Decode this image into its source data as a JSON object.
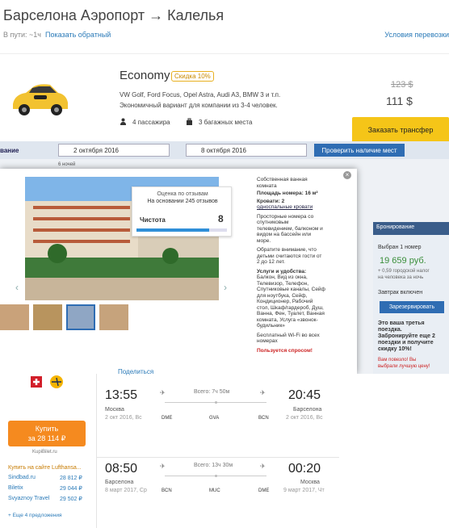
{
  "header": {
    "title": "Барселона Аэропорт → Калелья",
    "duration": "В пути: ~1ч",
    "show_return": "Показать обратный",
    "conditions": "Условия перевозки"
  },
  "transfer": {
    "class_name": "Economy",
    "discount": "Скидка 10%",
    "cars": "VW Golf, Ford Focus, Opel Astra, Audi A3, BMW 3 и т.п.",
    "description": "Экономичный вариант для компании из 3-4 человек.",
    "passengers": "4 пассажира",
    "bags": "3 багажных места",
    "old_price": "123 $",
    "new_price": "111 $",
    "order_button": "Заказать трансфер",
    "car_color": "#f2c230"
  },
  "hotel_bg": {
    "ot_label": "вание",
    "checkin": "2 октября 2016",
    "checkout": "8 октября 2016",
    "check_button": "Проверить наличие мест",
    "nights": "6 ночей",
    "booking_header": "Бронирование",
    "selected": "Выбран 1 номер",
    "price": "19 659 руб.",
    "tax": "+ 0,59 городской налог",
    "tax2": "на человека за ночь",
    "breakfast": "Завтрак включен",
    "reserve_button": "Зарезервировать",
    "third": "Это ваша третья",
    "third2": "поездка.",
    "third3": "Забронируйте еще 2",
    "third4": "поездки и получите",
    "third5": "скидку 10%!",
    "hurry": "Вам повезло! Вы",
    "hurry2": "выбрали лучшую цену!"
  },
  "modal": {
    "close": "×",
    "rating_title": "Оценка по отзывам",
    "rating_count": "На основании 245 отзывов",
    "clean_label": "Чистота",
    "clean_score": "8",
    "clean_fraction": 0.8,
    "prev": "‹",
    "next": "›",
    "d1": "Собственная ванная",
    "d1b": "комната",
    "d2": "Площадь номера: 16 м²",
    "d3": "Кровати: 2",
    "d3b": "односпальные кровати",
    "d4": "Просторные номера со",
    "d4b": "спутниковым",
    "d4c": "телевидением, балконом и",
    "d4d": "видом на бассейн или",
    "d4e": "море.",
    "d5": "Обратите внимание, что",
    "d5b": "детьми считаются гости от",
    "d5c": "2 до 12 лет.",
    "d6": "Услуги и удобства:",
    "d6b": "Балкон, Вид из окна,",
    "d6c": "Телевизор, Телефон,",
    "d6d": "Спутниковые каналы, Сейф",
    "d6e": "для ноутбука, Сейф,",
    "d6f": "Кондиционер, Рабочий",
    "d6g": "стол, Шкаф/гардероб, Душ,",
    "d6h": "Ванна, Фен, Туалет, Ванная",
    "d6i": "комната, Услуга «звонок-",
    "d6j": "будильник»",
    "d7": "Бесплатный Wi-Fi во всех",
    "d7b": "номерах",
    "d8": "Пользуется спросом!"
  },
  "flights": {
    "share": "Поделиться",
    "buy_line1": "Купить",
    "buy_line2": "за 28 114 ₽",
    "vendor": "KupiBilet.ru",
    "agencies_title": "Купить на сайте Lufthansa...",
    "agencies": [
      {
        "name": "Sindbad.ru",
        "price": "28 812 ₽"
      },
      {
        "name": "Biletix",
        "price": "29 044 ₽"
      },
      {
        "name": "Svyaznoy Travel",
        "price": "29 502 ₽"
      }
    ],
    "more_offers": "+ Еще 4 предложения",
    "seg1": {
      "dep_time": "13:55",
      "dep_city": "Москва",
      "dep_date": "2 окт 2016, Вс",
      "duration": "Всего: 7ч 50м",
      "arr_time": "20:45",
      "arr_city": "Барселона",
      "arr_date": "2 окт 2016, Вс",
      "codes": [
        "DME",
        "GVA",
        "BCN"
      ]
    },
    "seg2": {
      "dep_time": "08:50",
      "dep_city": "Барселона",
      "dep_date": "8 март 2017, Ср",
      "duration": "Всего: 13ч 30м",
      "arr_time": "00:20",
      "arr_city": "Москва",
      "arr_date": "9 март 2017, Чт",
      "codes": [
        "BCN",
        "MUC",
        "DME"
      ]
    }
  }
}
